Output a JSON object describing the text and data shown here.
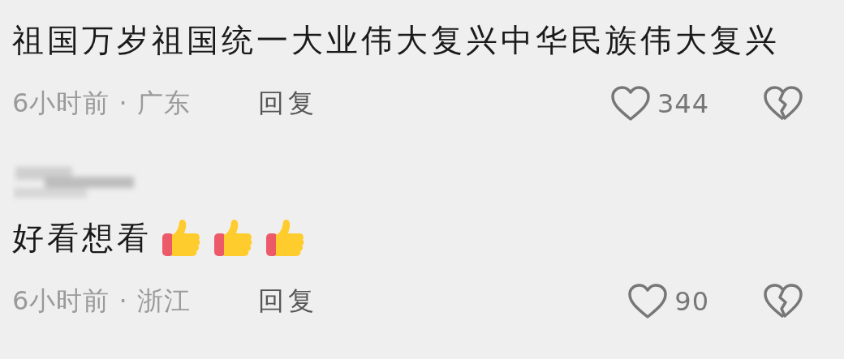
{
  "comments": [
    {
      "text": "祖国万岁祖国统一大业伟大复兴中华民族伟大复兴",
      "meta": "6小时前 · 广东",
      "reply": "回复",
      "likes": "344"
    },
    {
      "author": {
        "blurred": true
      },
      "text": "好看想看",
      "emojis": [
        {
          "kind": "thumbs-up"
        },
        {
          "kind": "thumbs-up"
        },
        {
          "kind": "thumbs-up"
        }
      ],
      "meta": "6小时前 · 浙江",
      "reply": "回复",
      "likes": "90"
    }
  ]
}
